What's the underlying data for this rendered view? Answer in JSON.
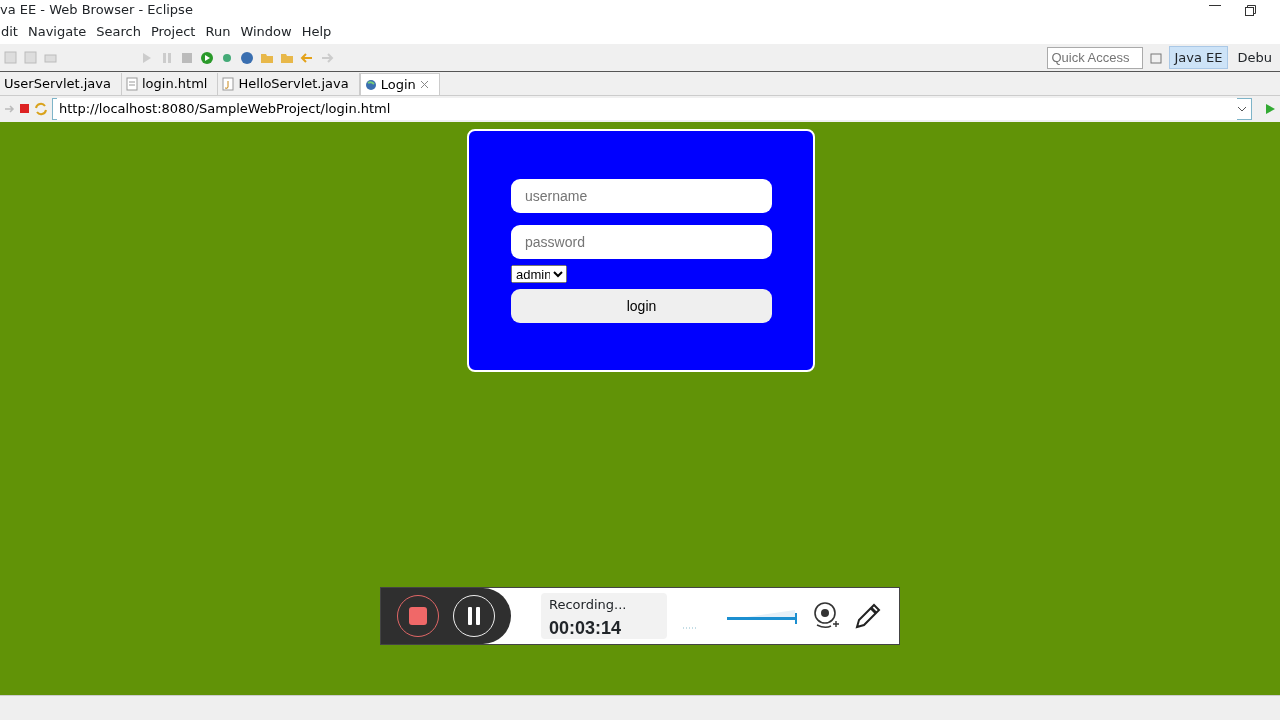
{
  "window": {
    "title": "va EE - Web Browser - Eclipse"
  },
  "menu": [
    {
      "label": "dit"
    },
    {
      "label": "Navigate"
    },
    {
      "label": "Search"
    },
    {
      "label": "Project"
    },
    {
      "label": "Run"
    },
    {
      "label": "Window"
    },
    {
      "label": "Help"
    }
  ],
  "quick_access": {
    "placeholder": "Quick Access"
  },
  "perspectives": [
    {
      "label": "Java EE",
      "selected": true
    },
    {
      "label": "Debu",
      "selected": false
    }
  ],
  "editor_tabs": [
    {
      "label": "UserServlet.java",
      "selected": false
    },
    {
      "label": "login.html",
      "kind": "html",
      "selected": false
    },
    {
      "label": "HelloServlet.java",
      "kind": "java",
      "selected": false
    },
    {
      "label": "Login",
      "kind": "browser",
      "selected": true
    }
  ],
  "address": {
    "value": "http://localhost:8080/SampleWebProject/login.html"
  },
  "login_form": {
    "username_placeholder": "username",
    "password_placeholder": "password",
    "role": "admin",
    "button": "login"
  },
  "recorder": {
    "status": "Recording...",
    "elapsed": "00:03:14",
    "volume": {
      "level": 1
    }
  }
}
